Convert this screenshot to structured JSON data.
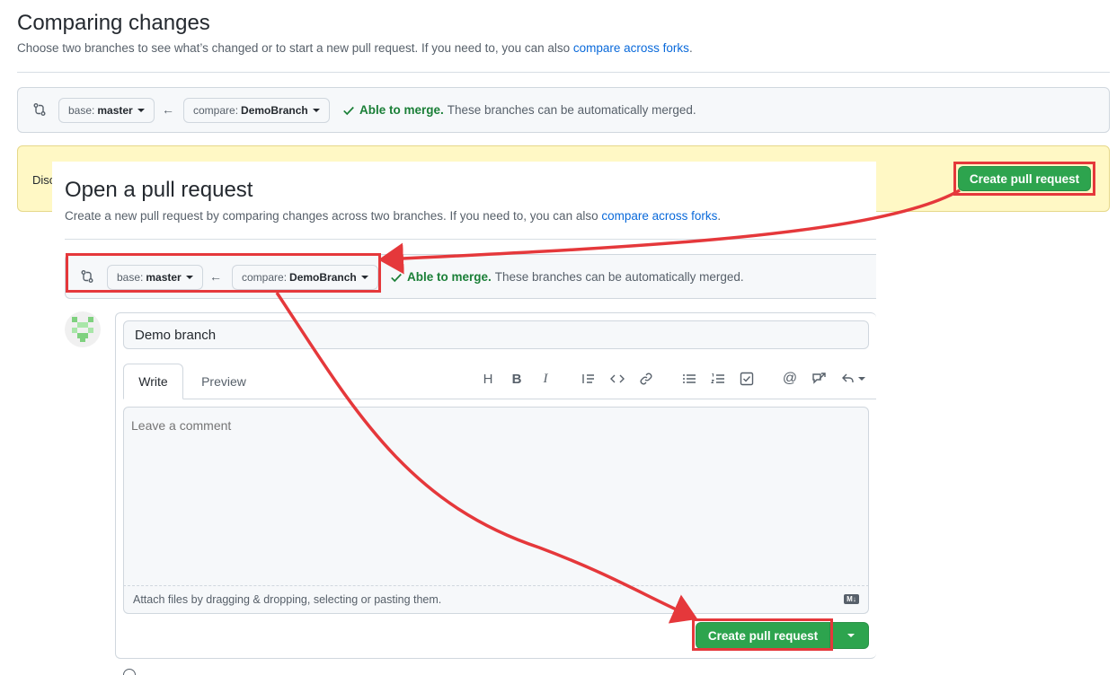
{
  "background_page": {
    "title": "Comparing changes",
    "subtitle_prefix": "Choose two branches to see what’s changed or to start a new pull request. If you need to, you can also ",
    "subtitle_link": "compare across forks",
    "subtitle_suffix": ".",
    "range": {
      "base_label": "base:",
      "base_value": "master",
      "compare_label": "compare:",
      "compare_value": "DemoBranch",
      "merge_status": "Able to merge.",
      "merge_detail": "These branches can be automatically merged."
    },
    "banner_text": "Disc",
    "create_button": "Create pull request"
  },
  "overlay": {
    "title": "Open a pull request",
    "subtitle_prefix": "Create a new pull request by comparing changes across two branches. If you need to, you can also ",
    "subtitle_link": "compare across forks",
    "subtitle_suffix": ".",
    "range": {
      "base_label": "base:",
      "base_value": "master",
      "compare_label": "compare:",
      "compare_value": "DemoBranch",
      "merge_status": "Able to merge.",
      "merge_detail": "These branches can be automatically merged."
    },
    "form": {
      "title_value": "Demo branch",
      "tabs": [
        "Write",
        "Preview"
      ],
      "toolbar_icons": [
        "heading-icon",
        "bold-icon",
        "italic-icon",
        "quote-icon",
        "code-icon",
        "link-icon",
        "unordered-list-icon",
        "ordered-list-icon",
        "task-list-icon",
        "mention-icon",
        "reference-icon",
        "reply-icon"
      ],
      "comment_placeholder": "Leave a comment",
      "attach_text": "Attach files by dragging & dropping, selecting or pasting them.",
      "markdown_badge": "M↓",
      "submit_button": "Create pull request"
    }
  },
  "annotation_color": "#e5383b",
  "accent_colors": {
    "green": "#2da44e",
    "link": "#0969da",
    "success": "#1a7f37"
  }
}
